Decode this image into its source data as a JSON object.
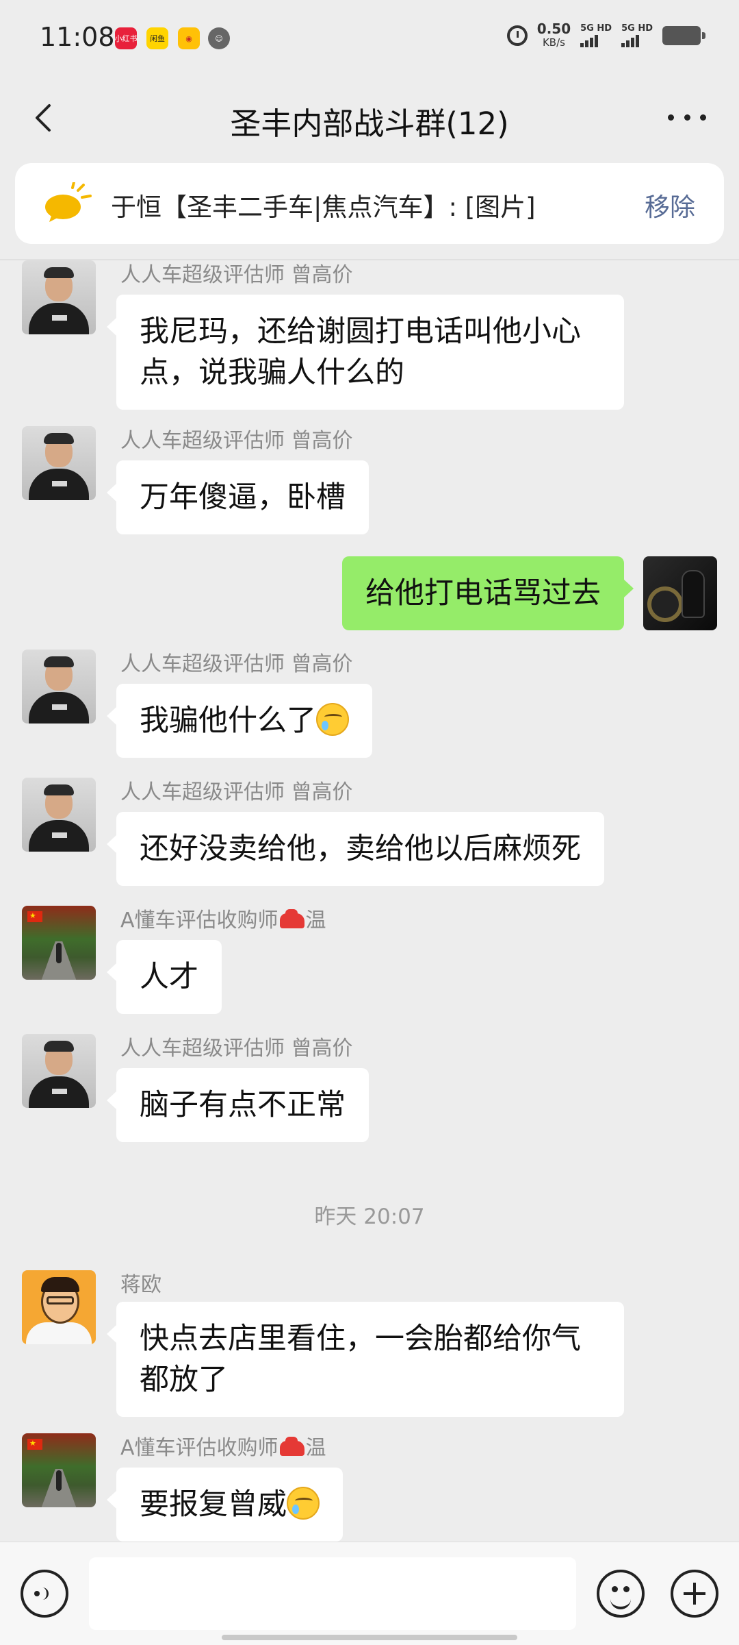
{
  "status_bar": {
    "time": "11:08",
    "apps": [
      "小红书",
      "闲鱼",
      "微博",
      "App"
    ],
    "net_speed": "0.50",
    "net_unit": "KB/s",
    "sim1": "5G HD",
    "sim2": "5G HD"
  },
  "header": {
    "title": "圣丰内部战斗群(12)"
  },
  "pinned": {
    "text": "于恒【圣丰二手车|焦点汽车】: [图片]",
    "remove_label": "移除"
  },
  "messages": [
    {
      "sender": "人人车超级评估师 曾高价",
      "text": "我尼玛，还给谢圆打电话叫他小心点，说我骗人什么的"
    },
    {
      "sender": "人人车超级评估师 曾高价",
      "text": "万年傻逼，卧槽"
    },
    {
      "sender": "",
      "text": "给他打电话骂过去"
    },
    {
      "sender": "人人车超级评估师 曾高价",
      "text": "我骗他什么了"
    },
    {
      "sender": "人人车超级评估师 曾高价",
      "text": "还好没卖给他，卖给他以后麻烦死"
    },
    {
      "sender_a": "A懂车评估收购师",
      "sender_b": "温",
      "text": "人才"
    },
    {
      "sender": "人人车超级评估师 曾高价",
      "text": "脑子有点不正常"
    },
    {
      "sender": "蒋欧",
      "text": "快点去店里看住，一会胎都给你气都放了"
    },
    {
      "sender_a": "A懂车评估收购师",
      "sender_b": "温",
      "text": "要报复曾威"
    }
  ],
  "timestamp": "昨天 20:07",
  "input": {
    "value": ""
  },
  "colors": {
    "background": "#ededed",
    "outgoing_bubble": "#95ec69",
    "incoming_bubble": "#ffffff",
    "link_blue": "#576b95"
  },
  "icons": [
    "back-icon",
    "more-icon",
    "bell-icon",
    "voice-icon",
    "emoji-icon",
    "plus-icon",
    "alarm-icon",
    "battery-icon",
    "crying-emoji",
    "car-emoji"
  ]
}
